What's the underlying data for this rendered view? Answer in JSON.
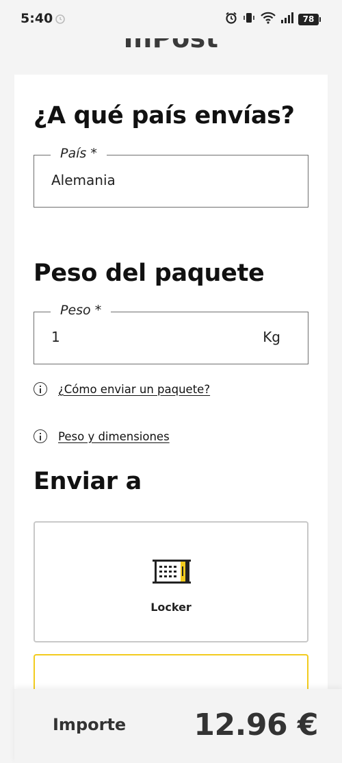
{
  "status_bar": {
    "time": "5:40",
    "battery": "78"
  },
  "brand": {
    "logo_text": "InPost"
  },
  "country_section": {
    "title": "¿A qué país envías?",
    "field_label": "País *",
    "field_value": "Alemania"
  },
  "weight_section": {
    "title": "Peso del paquete",
    "field_label": "Peso *",
    "field_value": "1",
    "unit": "Kg"
  },
  "help_links": [
    {
      "label": "¿Cómo enviar un paquete?"
    },
    {
      "label": "Peso y dimensiones"
    }
  ],
  "send_to": {
    "title": "Enviar a",
    "options": [
      {
        "label": "Locker",
        "icon": "locker-icon"
      }
    ]
  },
  "total": {
    "label": "Importe",
    "amount": "12.96 €"
  },
  "colors": {
    "accent": "#f2cb1d",
    "card_bg": "#ffffff",
    "page_bg": "#f4f4f4"
  }
}
